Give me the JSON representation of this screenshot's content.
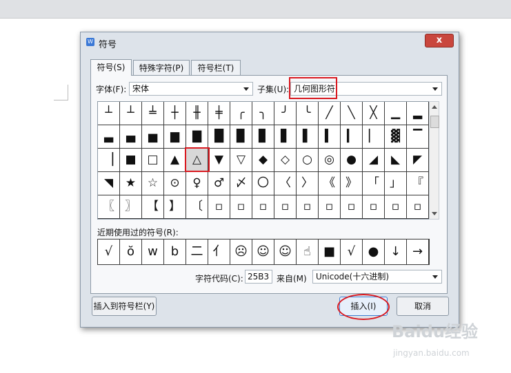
{
  "dialog": {
    "title": "符号",
    "close": "x",
    "tabs": [
      "符号(S)",
      "特殊字符(P)",
      "符号栏(T)"
    ],
    "font_label": "字体(F):",
    "font_value": "宋体",
    "subset_label": "子集(U):",
    "subset_value": "几何图形符",
    "recent_label": "近期使用过的符号(R):",
    "code_label": "字符代码(C):",
    "code_value": "25B3",
    "from_label": "来自(M)",
    "from_value": "Unicode(十六进制)",
    "btn_add_bar": "插入到符号栏(Y)",
    "btn_insert": "插入(I)",
    "btn_cancel": "取消"
  },
  "symbols": [
    [
      "┴",
      "┴",
      "╧",
      "┼",
      "╫",
      "╪",
      "╭",
      "╮",
      "╯",
      "╰",
      "╱",
      "╲",
      "╳",
      "▁",
      "▂"
    ],
    [
      "▃",
      "▄",
      "▅",
      "▆",
      "▇",
      "█",
      "▉",
      "▊",
      "▋",
      "▌",
      "▍",
      "▎",
      "▏",
      "▓",
      "▔"
    ],
    [
      "▕",
      "■",
      "□",
      "▲",
      "△",
      "▼",
      "▽",
      "◆",
      "◇",
      "○",
      "◎",
      "●",
      "◢",
      "◣",
      "◤"
    ],
    [
      "◥",
      "★",
      "☆",
      "⊙",
      "♀",
      "♂",
      "〆",
      "〇",
      "〈",
      "〉",
      "《",
      "》",
      "「",
      "」",
      "『"
    ],
    [
      "〖",
      "〗",
      "【",
      "】",
      "〔",
      "▫",
      "▫",
      "▫",
      "▫",
      "▫",
      "▫",
      "▫",
      "▫",
      "▫",
      "▫"
    ]
  ],
  "recent_symbols": [
    "√",
    "ŏ",
    "w",
    "b",
    "二",
    "亻",
    "☹",
    "☺",
    "☺",
    "☝",
    "■",
    "√",
    "●",
    "↓",
    "→"
  ],
  "watermark": {
    "main": "Baidu经验",
    "sub": "jingyan.baidu.com"
  }
}
